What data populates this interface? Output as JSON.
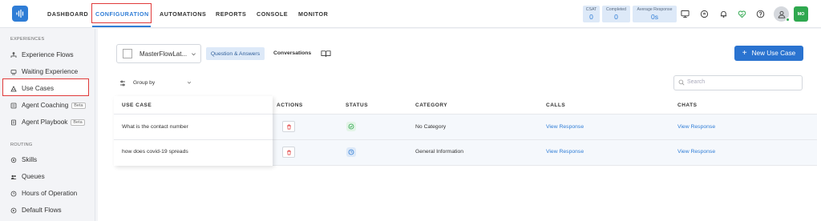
{
  "nav": {
    "items": [
      "DASHBOARD",
      "CONFIGURATION",
      "AUTOMATIONS",
      "REPORTS",
      "CONSOLE",
      "MONITOR"
    ],
    "active": "CONFIGURATION",
    "accent": "#2f7dd6",
    "highlight_color": "#e03a3a"
  },
  "stats": [
    {
      "label": "CSAT",
      "value": "0"
    },
    {
      "label": "Completed",
      "value": "0"
    },
    {
      "label": "Average Response",
      "value": "0s"
    }
  ],
  "header_icons": [
    "monitor-icon",
    "chat-icon",
    "bell-icon",
    "heart-shield-icon",
    "help-icon"
  ],
  "user": {
    "initials": "MO",
    "status_color": "#2fa84f"
  },
  "sidebar": {
    "sections": [
      {
        "title": "EXPERIENCES",
        "items": [
          {
            "label": "Experience Flows",
            "icon": "flow-icon"
          },
          {
            "label": "Waiting Experience",
            "icon": "waiting-icon"
          },
          {
            "label": "Use Cases",
            "icon": "use-case-icon",
            "active": true
          },
          {
            "label": "Agent Coaching",
            "icon": "coaching-icon",
            "badge": "Beta"
          },
          {
            "label": "Agent Playbook",
            "icon": "playbook-icon",
            "badge": "Beta"
          }
        ]
      },
      {
        "title": "ROUTING",
        "items": [
          {
            "label": "Skills",
            "icon": "skills-icon"
          },
          {
            "label": "Queues",
            "icon": "queues-icon"
          },
          {
            "label": "Hours of Operation",
            "icon": "clock-icon"
          },
          {
            "label": "Default Flows",
            "icon": "default-flows-icon"
          }
        ]
      }
    ]
  },
  "toolbar": {
    "flow_select_value": "MasterFlowLat...",
    "tab_active": "Question & Answers",
    "tab_other": "Conversations",
    "new_button": "New Use Case",
    "new_button_plus": "+"
  },
  "filters": {
    "groupby_label": "Group by",
    "search_placeholder": "Search"
  },
  "table": {
    "columns": [
      "USE CASE",
      "ACTIONS",
      "STATUS",
      "CATEGORY",
      "CALLS",
      "CHATS"
    ],
    "rows": [
      {
        "use_case": "What is the contact number",
        "status": "active",
        "category": "No Category",
        "calls": "View Response",
        "chats": "View Response"
      },
      {
        "use_case": "how does covid-19 spreads",
        "status": "scheduled",
        "category": "General Information",
        "calls": "View Response",
        "chats": "View Response"
      }
    ]
  }
}
